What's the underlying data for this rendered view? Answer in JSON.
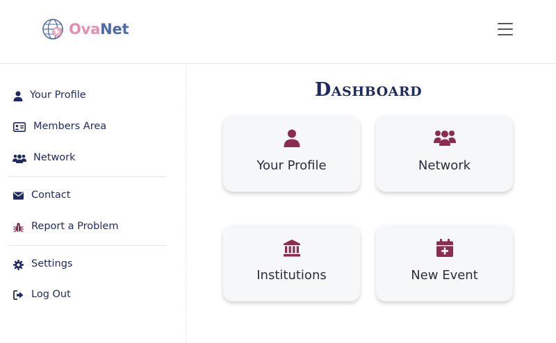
{
  "header": {
    "logo_part1": "Ova",
    "logo_part2": "Net"
  },
  "sidebar": {
    "items": [
      {
        "label": "Your Profile",
        "icon": "user-icon"
      },
      {
        "label": "Members Area",
        "icon": "id-card-icon"
      },
      {
        "label": "Network",
        "icon": "users-icon"
      },
      {
        "label": "Contact",
        "icon": "envelope-icon"
      },
      {
        "label": "Report a Problem",
        "icon": "bug-icon"
      },
      {
        "label": "Settings",
        "icon": "gear-icon"
      },
      {
        "label": "Log Out",
        "icon": "sign-out-icon"
      }
    ]
  },
  "main": {
    "title": "Dashboard",
    "cards": [
      {
        "label": "Your Profile",
        "icon": "user-icon"
      },
      {
        "label": "Network",
        "icon": "users-icon"
      },
      {
        "label": "Institutions",
        "icon": "institution-icon"
      },
      {
        "label": "New Event",
        "icon": "calendar-plus-icon"
      }
    ]
  },
  "colors": {
    "navy": "#1f2a63",
    "accent": "#8c2d4f",
    "logo_pink": "#e58fab",
    "logo_blue": "#4d6aa8",
    "card_bg": "#f6f7f9"
  }
}
